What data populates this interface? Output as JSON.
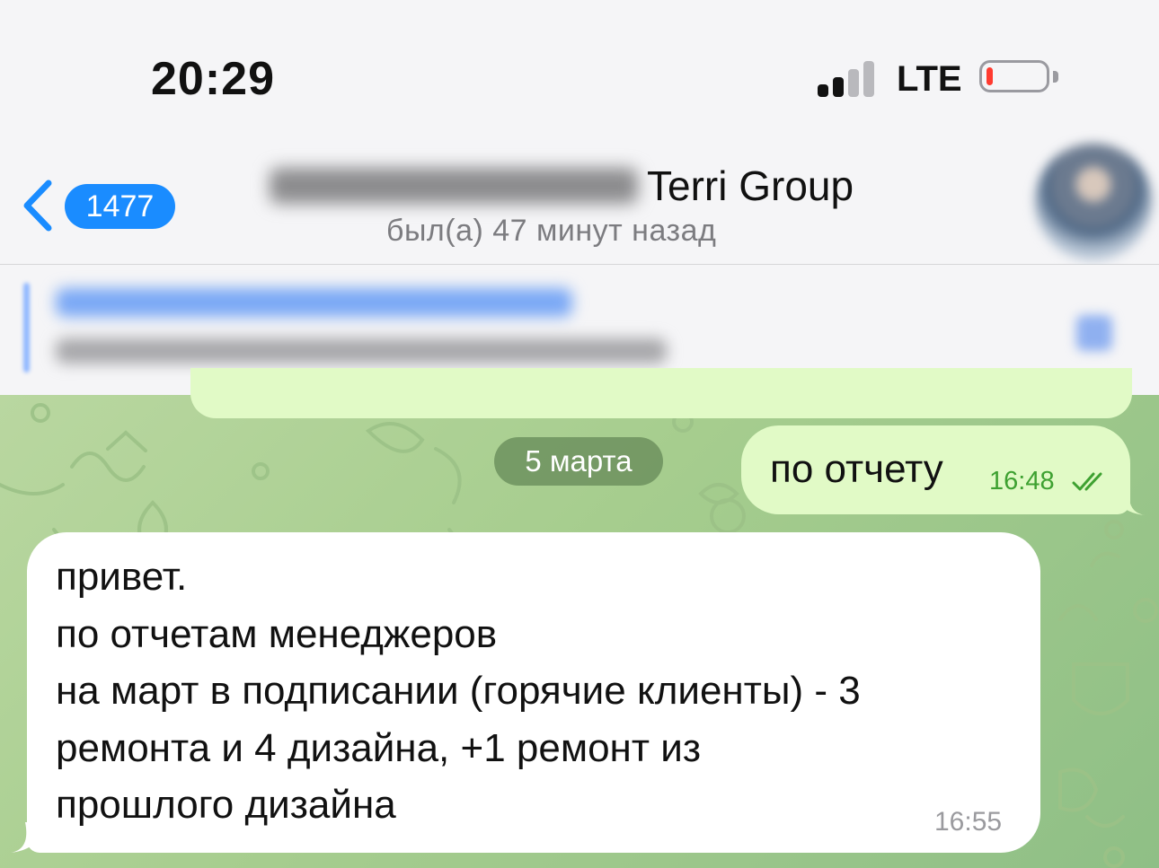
{
  "status_bar": {
    "time": "20:29",
    "network": "LTE",
    "signal_bars_active": 2,
    "signal_bars_total": 4,
    "battery_level_fraction": 0.1,
    "battery_color": "#ff3b30"
  },
  "header": {
    "back_icon": "chevron-left-icon",
    "unread_count": "1477",
    "title": "Terri Group",
    "subtitle": "был(а) 47 минут назад",
    "accent": "#1a8cff"
  },
  "pinned_message": {
    "close_icon": "close-icon"
  },
  "chat": {
    "date_separator": "5 марта",
    "outgoing": {
      "text": "по отчету",
      "time": "16:48",
      "status_icon": "double-check-icon",
      "bubble_color": "#e1fac6"
    },
    "incoming": {
      "lines": [
        "привет.",
        "по отчетам менеджеров",
        "на март в подписании (горячие клиенты) - 3",
        "ремонта и 4 дизайна, +1 ремонт из",
        "прошлого дизайна"
      ],
      "time": "16:55",
      "bubble_color": "#ffffff"
    }
  }
}
